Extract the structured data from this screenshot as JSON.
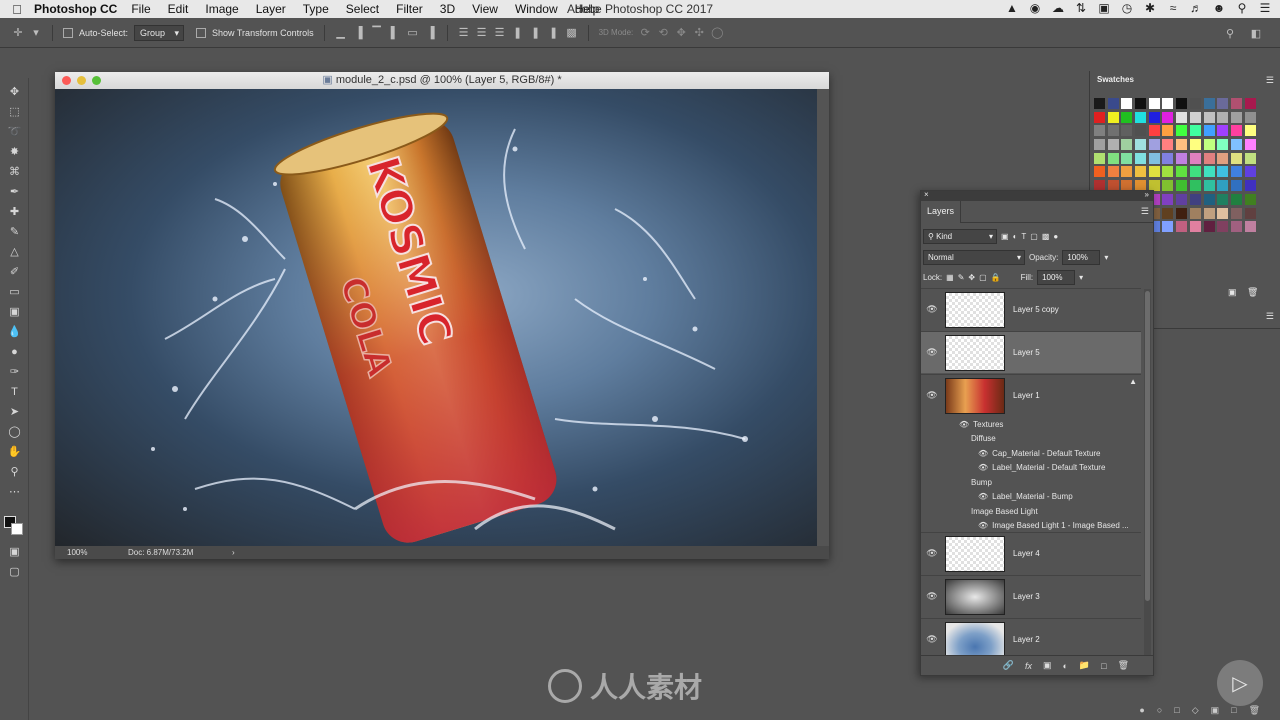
{
  "menubar": {
    "app_name": "Photoshop CC",
    "items": [
      "File",
      "Edit",
      "Image",
      "Layer",
      "Type",
      "Select",
      "Filter",
      "3D",
      "View",
      "Window",
      "Help"
    ],
    "window_title": "Adobe Photoshop CC 2017"
  },
  "options_bar": {
    "auto_select_label": "Auto-Select:",
    "auto_select_value": "Group",
    "transform_controls_label": "Show Transform Controls",
    "mode_3d_label": "3D Mode:"
  },
  "document": {
    "title": "module_2_c.psd @ 100% (Layer 5, RGB/8#) *",
    "zoom": "100%",
    "doc_size": "Doc: 6.87M/73.2M",
    "can_text_1": "KOSMIC",
    "can_text_2": "COLA"
  },
  "swatches_panel": {
    "title": "Swatches",
    "colors": [
      "#1a1a1a",
      "#3a4a8c",
      "#ffffff",
      "#111111",
      "#ffffff",
      "#ffffff",
      "#111111",
      "#505050",
      "#3a6f9a",
      "#6a6a9a",
      "#b05070",
      "#a8194e",
      "#e02020",
      "#f0f020",
      "#20c020",
      "#20e0e0",
      "#2020e0",
      "#e020e0",
      "#e0e0e0",
      "#d0d0d0",
      "#c0c0c0",
      "#b0b0b0",
      "#a0a0a0",
      "#909090",
      "#808080",
      "#707070",
      "#606060",
      "#505050",
      "#ff4040",
      "#ffa040",
      "#40ff40",
      "#40ffa0",
      "#40a0ff",
      "#a040ff",
      "#ff40a0",
      "#ffff80",
      "#a0a0a0",
      "#b0b0b0",
      "#a0d0a0",
      "#a0e0e0",
      "#a0a0e0",
      "#ff8080",
      "#ffc080",
      "#ffff80",
      "#c0ff80",
      "#80ffc0",
      "#80c0ff",
      "#ff80ff",
      "#b0e070",
      "#80e080",
      "#80e0a0",
      "#80e0e0",
      "#80c0e0",
      "#8080e0",
      "#c080e0",
      "#e080c0",
      "#e08080",
      "#e0a080",
      "#e0e080",
      "#c0e080",
      "#f06020",
      "#f08040",
      "#f0a040",
      "#f0c040",
      "#e0e040",
      "#a0e040",
      "#60e040",
      "#40e080",
      "#40e0c0",
      "#40c0e0",
      "#4080e0",
      "#6040e0",
      "#b03030",
      "#c05030",
      "#d07030",
      "#e09030",
      "#c0c030",
      "#80c030",
      "#40c030",
      "#30c060",
      "#30c0a0",
      "#30a0c0",
      "#3070c0",
      "#4030c0",
      "#e020a0",
      "#c02080",
      "#a02060",
      "#802040",
      "#b040c0",
      "#8040c0",
      "#6040a0",
      "#404080",
      "#206080",
      "#208060",
      "#208040",
      "#408020",
      "#802020",
      "#a06040",
      "#c08060",
      "#e0a080",
      "#806040",
      "#604020",
      "#402010",
      "#a08060",
      "#c0a080",
      "#e0c0a0",
      "#806060",
      "#604040",
      "#a02020",
      "#c04040",
      "#2040a0",
      "#4060c0",
      "#6080e0",
      "#80a0ff",
      "#c06080",
      "#e080a0",
      "#602040",
      "#804060",
      "#a06080",
      "#c080a0"
    ]
  },
  "layers_panel": {
    "tab": "Layers",
    "filter_kind": "Kind",
    "blend_mode": "Normal",
    "opacity_label": "Opacity:",
    "opacity_value": "100%",
    "lock_label": "Lock:",
    "fill_label": "Fill:",
    "fill_value": "100%",
    "layers": [
      {
        "name": "Layer 5 copy"
      },
      {
        "name": "Layer 5"
      },
      {
        "name": "Layer 1"
      }
    ],
    "layer1_effects": {
      "textures": "Textures",
      "diffuse": "Diffuse",
      "cap": "Cap_Material - Default Texture",
      "label": "Label_Material - Default Texture",
      "bump": "Bump",
      "label_bump": "Label_Material - Bump",
      "ibl": "Image Based Light",
      "ibl_item": "Image Based Light 1 - Image Based ..."
    },
    "lower_layers": [
      {
        "name": "Layer 4"
      },
      {
        "name": "Layer 3"
      },
      {
        "name": "Layer 2"
      }
    ]
  },
  "watermark": "人人素材"
}
